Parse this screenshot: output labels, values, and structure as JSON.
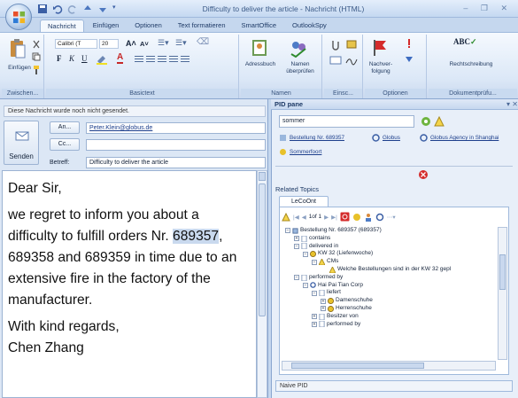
{
  "window": {
    "title": "Difficulty to deliver the article - Nachricht (HTML)",
    "controls": "– ❐ ✕"
  },
  "tabs": [
    "Nachricht",
    "Einfügen",
    "Optionen",
    "Text formatieren",
    "SmartOffice",
    "OutlookSpy"
  ],
  "ribbon": {
    "clipboard": {
      "label": "Zwischen...",
      "paste": "Einfügen"
    },
    "basic_text": {
      "label": "Basictext",
      "font": "Calibri (T",
      "size": "20"
    },
    "names": {
      "label": "Namen",
      "addressbook": "Adressbuch",
      "check_names": "Namen überprüfen"
    },
    "include": {
      "label": "Einsc..."
    },
    "options": {
      "label": "Optionen",
      "followup": "Nachver-folgung"
    },
    "proofing": {
      "label": "Dokumentprüfu...",
      "spelling": "Rechtschreibung",
      "abc": "ABC"
    }
  },
  "compose": {
    "info": "Diese Nachricht wurde noch nicht gesendet.",
    "send": "Senden",
    "to_btn": "An...",
    "cc_btn": "Cc...",
    "subject_label": "Betreff:",
    "to_value": "Peter.Klein@globus.de",
    "cc_value": "",
    "subject_value": "Difficulty to deliver the article",
    "body": {
      "greeting": "Dear Sir,",
      "p1_a": "we regret to inform you about a difficulty to fulfill orders Nr. ",
      "p1_hl": "689357",
      "p1_b": ", 689358 and 689359 in time due to an extensive fire in the factory of the manufacturer.",
      "closing": "With kind regards,",
      "sender": "Chen Zhang"
    }
  },
  "pid": {
    "title": "PID pane",
    "search": "sommer",
    "links": [
      "Bestellung Nr. 689357",
      "Globus",
      "Globus Agency in Shanghai",
      "Sommerfoort"
    ],
    "related": "Related Topics",
    "concept_tab": "LeCoOnt Concepts",
    "pager": "1of 1",
    "naive": "Naive PID",
    "tree": [
      {
        "text": "Bestellung Nr. 689357 (689357)",
        "indent": 0,
        "pm": "−",
        "icon": "doc"
      },
      {
        "text": "contains",
        "indent": 1,
        "pm": "+",
        "icon": "rel"
      },
      {
        "text": "delivered in",
        "indent": 1,
        "pm": "−",
        "icon": "rel"
      },
      {
        "text": "KW 32 (Liefenwoche)",
        "indent": 2,
        "pm": "−",
        "icon": "yellow"
      },
      {
        "text": "CMs",
        "indent": 3,
        "pm": "−",
        "icon": "warn"
      },
      {
        "text": "Welche Bestellungen sind in der KW 32 gepl",
        "indent": 4,
        "pm": "",
        "icon": "warn"
      },
      {
        "text": "performed by",
        "indent": 1,
        "pm": "−",
        "icon": "rel"
      },
      {
        "text": "Hai Pai Tian Corp",
        "indent": 2,
        "pm": "−",
        "icon": "blue"
      },
      {
        "text": "liefert",
        "indent": 3,
        "pm": "−",
        "icon": "rel"
      },
      {
        "text": "Damenschuhe",
        "indent": 4,
        "pm": "+",
        "icon": "yellow"
      },
      {
        "text": "Herrenschuhe",
        "indent": 4,
        "pm": "+",
        "icon": "yellow"
      },
      {
        "text": "Besitzer von",
        "indent": 3,
        "pm": "+",
        "icon": "rel"
      },
      {
        "text": "performed by",
        "indent": 3,
        "pm": "+",
        "icon": "rel"
      }
    ]
  }
}
